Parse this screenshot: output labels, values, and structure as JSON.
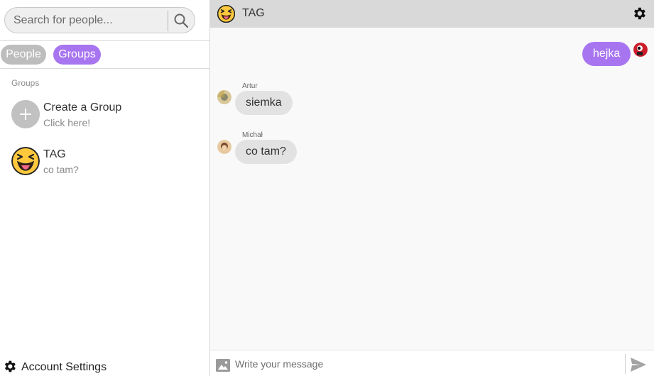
{
  "search": {
    "placeholder": "Search for people..."
  },
  "tabs": {
    "people": "People",
    "groups": "Groups"
  },
  "sidebar": {
    "section_label": "Groups",
    "create_group": {
      "title": "Create a Group",
      "subtitle": "Click here!"
    },
    "groups": [
      {
        "name": "TAG",
        "last_message": "co tam?",
        "icon": "tongue-out-emoji"
      }
    ],
    "account_settings": "Account Settings"
  },
  "chat": {
    "title": "TAG",
    "messages": [
      {
        "direction": "outgoing",
        "text": "hejka"
      },
      {
        "direction": "incoming",
        "sender": "Artur",
        "text": "siemka"
      },
      {
        "direction": "incoming",
        "sender": "Michał",
        "text": "co tam?"
      }
    ],
    "composer_placeholder": "Write your message"
  },
  "colors": {
    "accent": "#a875f0",
    "pill_inactive": "#bdbdbd",
    "header_bg": "#d9d9d9",
    "incoming_bubble": "#e2e2e2"
  },
  "icons": [
    "search-icon",
    "plus-icon",
    "tongue-out-emoji",
    "gear-icon",
    "image-icon",
    "send-icon"
  ]
}
